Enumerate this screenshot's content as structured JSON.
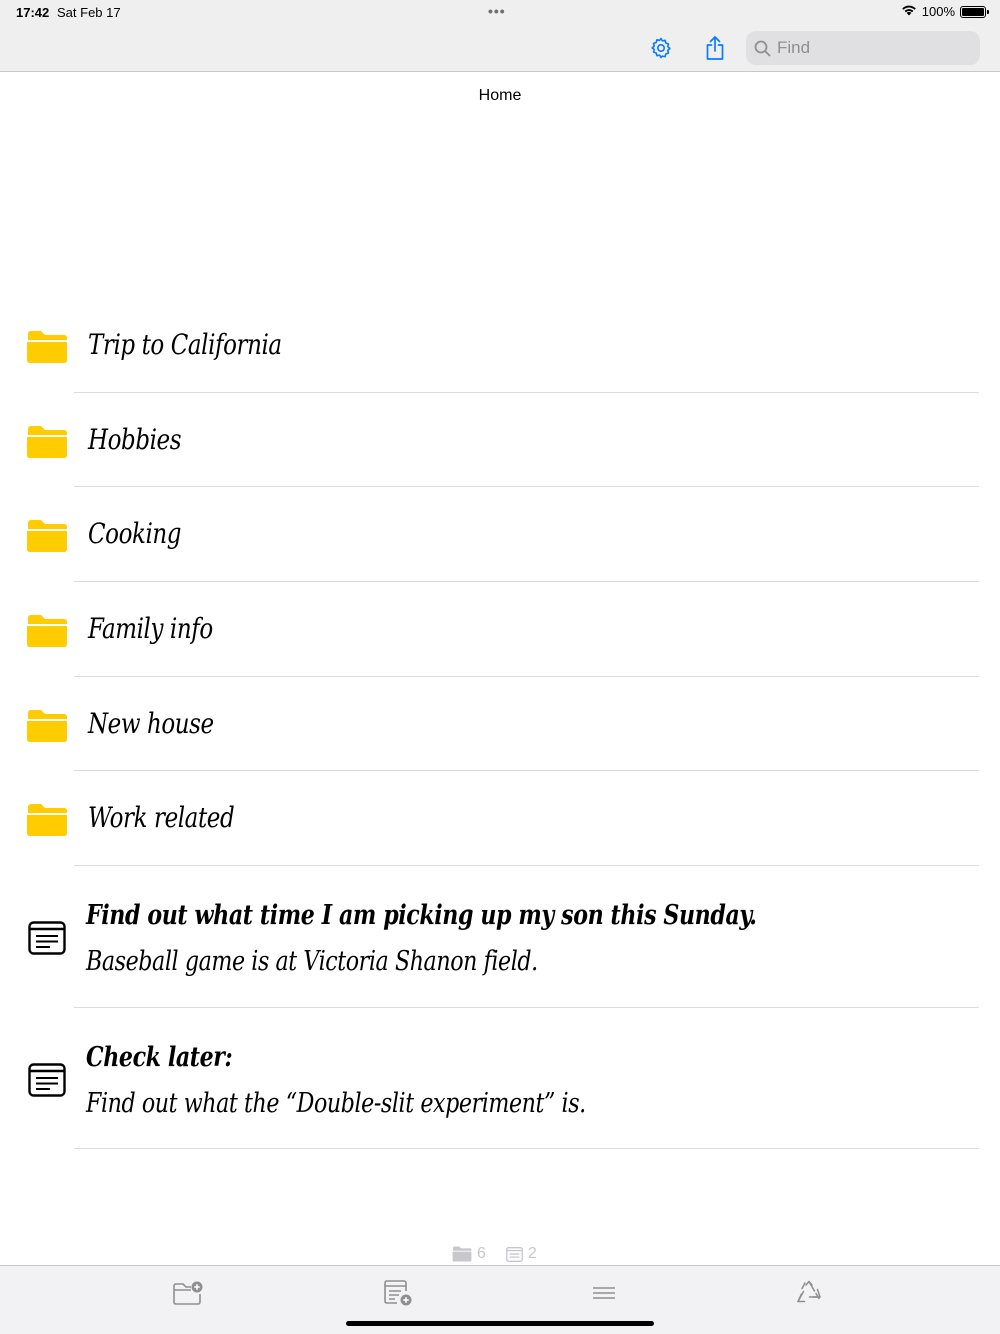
{
  "status": {
    "time": "17:42",
    "date": "Sat Feb 17",
    "battery": "100%"
  },
  "toolbar": {
    "search_placeholder": "Find",
    "settings_icon": "gear-icon",
    "share_icon": "share-icon"
  },
  "page": {
    "title": "Home"
  },
  "folders": [
    {
      "label": "Trip to California"
    },
    {
      "label": "Hobbies"
    },
    {
      "label": "Cooking"
    },
    {
      "label": "Family info"
    },
    {
      "label": "New house"
    },
    {
      "label": "Work related"
    }
  ],
  "notes": [
    {
      "title": "Find out what time I am picking up my son this Sunday.",
      "body": "Baseball game is at Victoria Shanon field."
    },
    {
      "title": "Check later:",
      "body": "Find out what the “Double-slit experiment” is."
    }
  ],
  "counts": {
    "folders": "6",
    "notes": "2"
  },
  "colors": {
    "accent": "#0a7aff",
    "folder": "#ffcc00",
    "toolbar_bg": "#efeff0"
  }
}
